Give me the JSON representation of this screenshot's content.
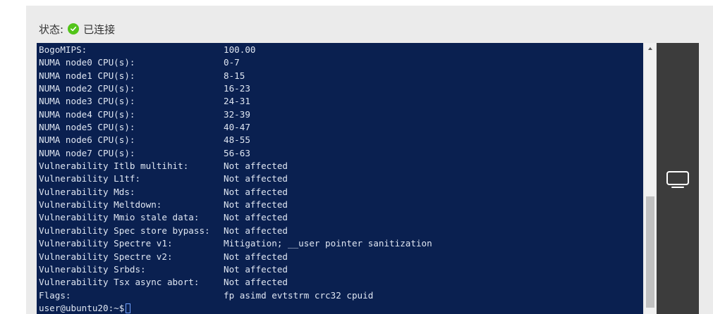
{
  "status": {
    "label": "状态:",
    "value": "已连接",
    "color": "#52c41a"
  },
  "terminal": {
    "lines": [
      {
        "key": "BogoMIPS:",
        "value": "100.00"
      },
      {
        "key": "NUMA node0 CPU(s):",
        "value": "0-7"
      },
      {
        "key": "NUMA node1 CPU(s):",
        "value": "8-15"
      },
      {
        "key": "NUMA node2 CPU(s):",
        "value": "16-23"
      },
      {
        "key": "NUMA node3 CPU(s):",
        "value": "24-31"
      },
      {
        "key": "NUMA node4 CPU(s):",
        "value": "32-39"
      },
      {
        "key": "NUMA node5 CPU(s):",
        "value": "40-47"
      },
      {
        "key": "NUMA node6 CPU(s):",
        "value": "48-55"
      },
      {
        "key": "NUMA node7 CPU(s):",
        "value": "56-63"
      },
      {
        "key": "Vulnerability Itlb multihit:",
        "value": "Not affected"
      },
      {
        "key": "Vulnerability L1tf:",
        "value": "Not affected"
      },
      {
        "key": "Vulnerability Mds:",
        "value": "Not affected"
      },
      {
        "key": "Vulnerability Meltdown:",
        "value": "Not affected"
      },
      {
        "key": "Vulnerability Mmio stale data:",
        "value": "Not affected"
      },
      {
        "key": "Vulnerability Spec store bypass:",
        "value": "Not affected"
      },
      {
        "key": "Vulnerability Spectre v1:",
        "value": "Mitigation; __user pointer sanitization"
      },
      {
        "key": "Vulnerability Spectre v2:",
        "value": "Not affected"
      },
      {
        "key": "Vulnerability Srbds:",
        "value": "Not affected"
      },
      {
        "key": "Vulnerability Tsx async abort:",
        "value": "Not affected"
      },
      {
        "key": "Flags:",
        "value": "fp asimd evtstrm crc32 cpuid"
      }
    ],
    "prompt": "user@ubuntu20:~$"
  },
  "side_panel": {
    "button_icon": "monitor-icon"
  }
}
